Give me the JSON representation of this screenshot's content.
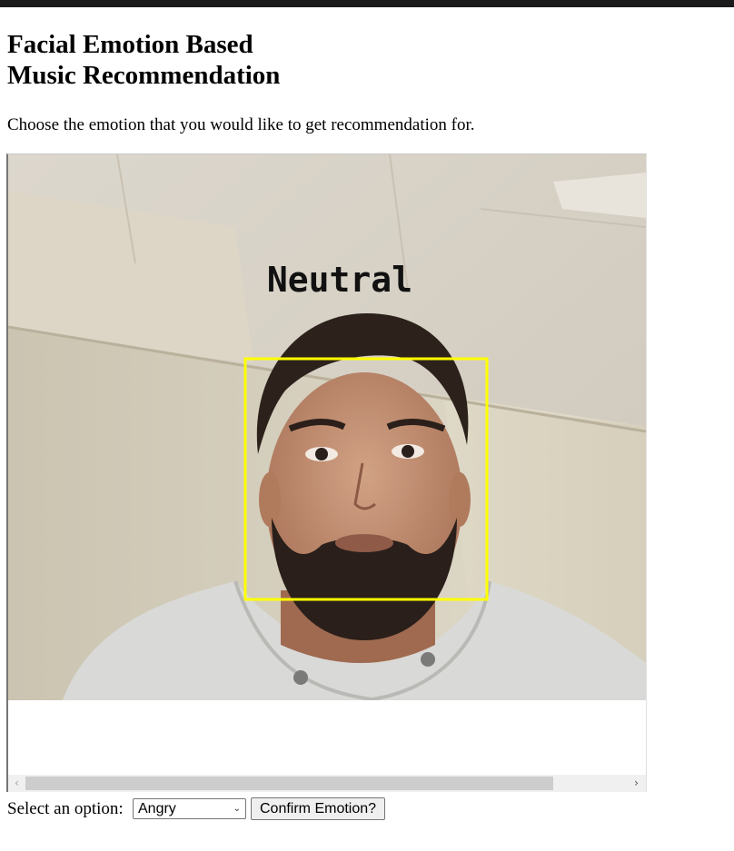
{
  "page": {
    "title_line1": "Facial Emotion Based",
    "title_line2": "Music Recommendation",
    "instruction": "Choose the emotion that you would like to get recommendation for."
  },
  "video": {
    "detected_emotion": "Neutral",
    "box_color": "#ffff00"
  },
  "scrollbar": {
    "left_arrow": "‹",
    "right_arrow": "›"
  },
  "form": {
    "select_label": "Select an option:",
    "select_value": "Angry",
    "select_chevron": "⌄",
    "confirm_label": "Confirm Emotion?"
  }
}
